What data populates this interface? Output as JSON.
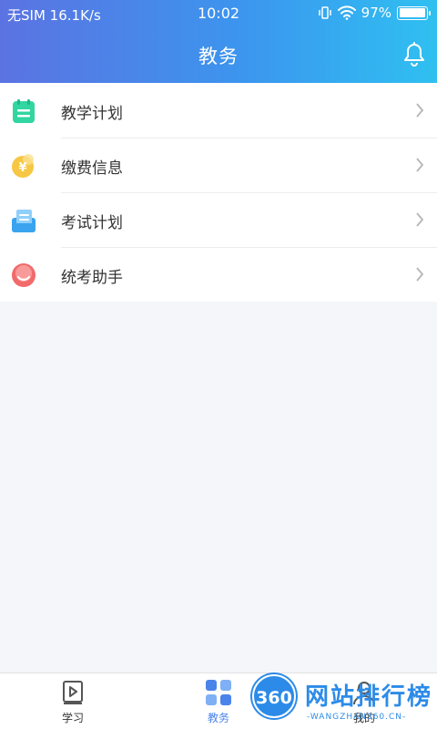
{
  "status_bar": {
    "carrier": "无SIM",
    "speed": "16.1K/s",
    "time": "10:02",
    "battery_percent": "97%",
    "battery_level": 0.97
  },
  "header": {
    "title": "教务",
    "bell_icon": "bell-icon"
  },
  "menu": {
    "items": [
      {
        "label": "教学计划",
        "icon": "notepad-icon",
        "color": "#31d6a0"
      },
      {
        "label": "缴费信息",
        "icon": "yuan-coin-icon",
        "color": "#f6c744"
      },
      {
        "label": "考试计划",
        "icon": "exam-paper-icon",
        "color": "#3aa3ef"
      },
      {
        "label": "统考助手",
        "icon": "smile-assistant-icon",
        "color": "#f26a6a"
      }
    ]
  },
  "tabbar": {
    "tabs": [
      {
        "label": "学习",
        "icon": "video-play-icon"
      },
      {
        "label": "教务",
        "icon": "grid-apps-icon",
        "active": true
      },
      {
        "label": "我的",
        "icon": "person-icon"
      }
    ]
  },
  "watermark": {
    "badge": "360",
    "text": "网站排行榜",
    "url": "-WANGZHAN360.CN-"
  },
  "colors": {
    "header_gradient_start": "#5b73e2",
    "header_gradient_end": "#2fc0f1",
    "active_tab": "#4a84ea",
    "background": "#f5f6fa"
  }
}
